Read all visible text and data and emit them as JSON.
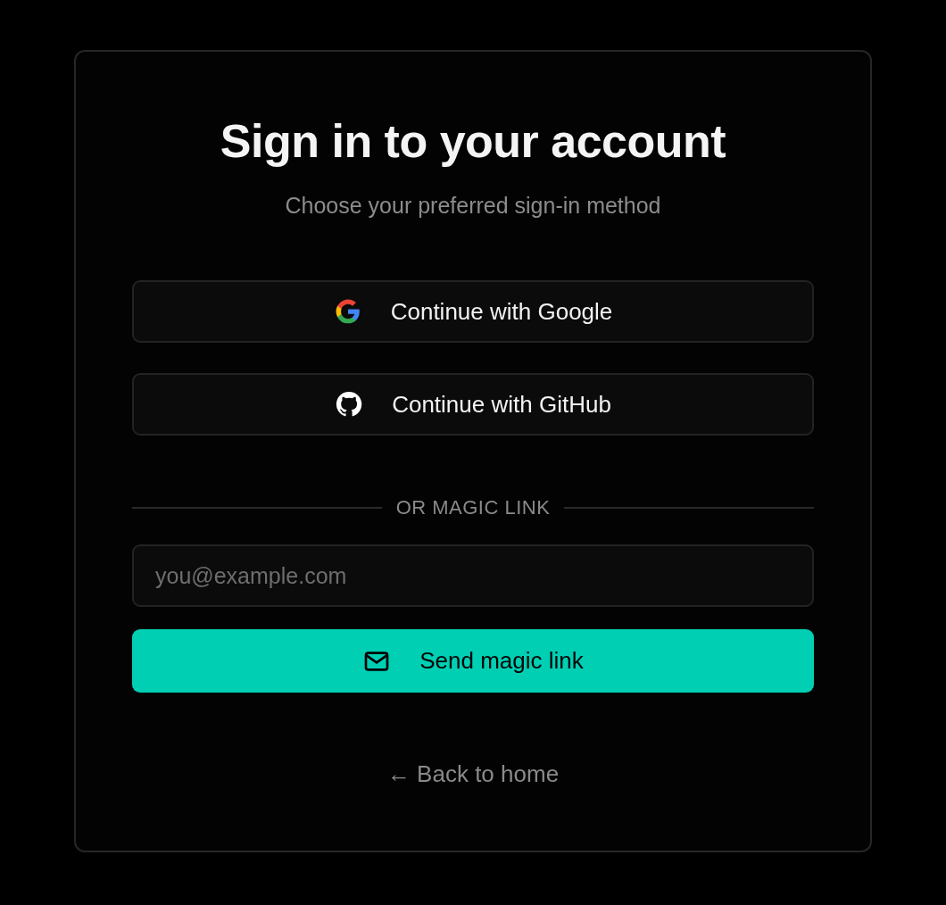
{
  "title": "Sign in to your account",
  "subtitle": "Choose your preferred sign-in method",
  "providers": [
    {
      "kind": "google",
      "label": "Continue with Google"
    },
    {
      "kind": "github",
      "label": "Continue with GitHub"
    }
  ],
  "divider": "OR MAGIC LINK",
  "email": {
    "placeholder": "you@example.com"
  },
  "submit": {
    "label": "Send magic link"
  },
  "back_link": "← Back to home"
}
